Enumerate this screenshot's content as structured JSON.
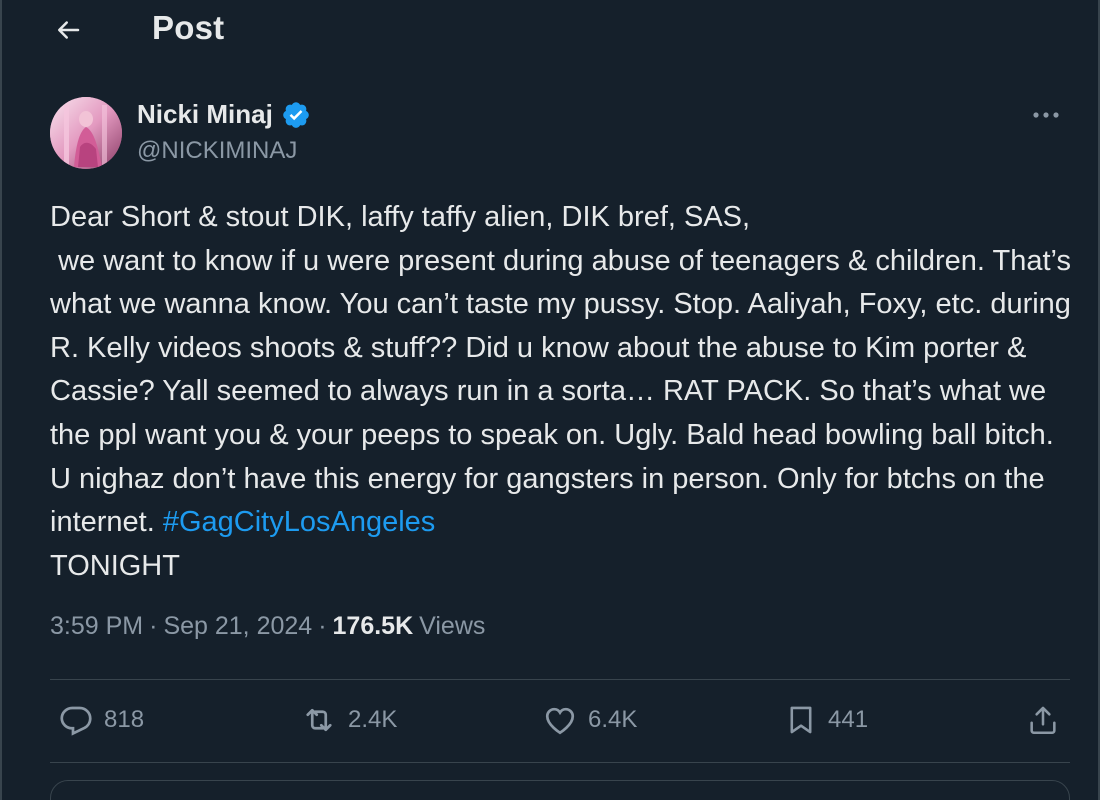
{
  "header": {
    "title": "Post"
  },
  "author": {
    "name": "Nicki Minaj",
    "handle": "@NICKIMINAJ"
  },
  "post": {
    "text": "Dear Short & stout DIK, laffy taffy alien, DIK bref, SAS,\n we want to know if u were present during abuse of teenagers & children. That’s what we wanna know. You can’t taste my pussy. Stop. Aaliyah, Foxy, etc. during R. Kelly videos shoots & stuff?? Did u know about the abuse to Kim porter & Cassie? Yall seemed to always run in a sorta… RAT PACK. So that’s what we the ppl want you & your peeps to speak on. Ugly. Bald head bowling ball bitch. U nighaz don’t have this energy for gangsters in person. Only for btchs on the internet. ",
    "hashtag": "#GagCityLosAngeles",
    "tail": "\nTONIGHT"
  },
  "meta": {
    "time": "3:59 PM",
    "separator": "·",
    "date": "Sep 21, 2024",
    "views_count": "176.5K",
    "views_label": "Views"
  },
  "actions": {
    "replies": "818",
    "reposts": "2.4K",
    "likes": "6.4K",
    "bookmarks": "441"
  },
  "colors": {
    "background": "#15202b",
    "text": "#e7e9ea",
    "muted": "#8b98a5",
    "accent": "#1d9bf0",
    "border": "#38444d"
  },
  "icons": [
    "back-arrow-icon",
    "verified-badge-icon",
    "more-dots-icon",
    "reply-icon",
    "repost-icon",
    "like-icon",
    "bookmark-icon",
    "share-icon"
  ]
}
